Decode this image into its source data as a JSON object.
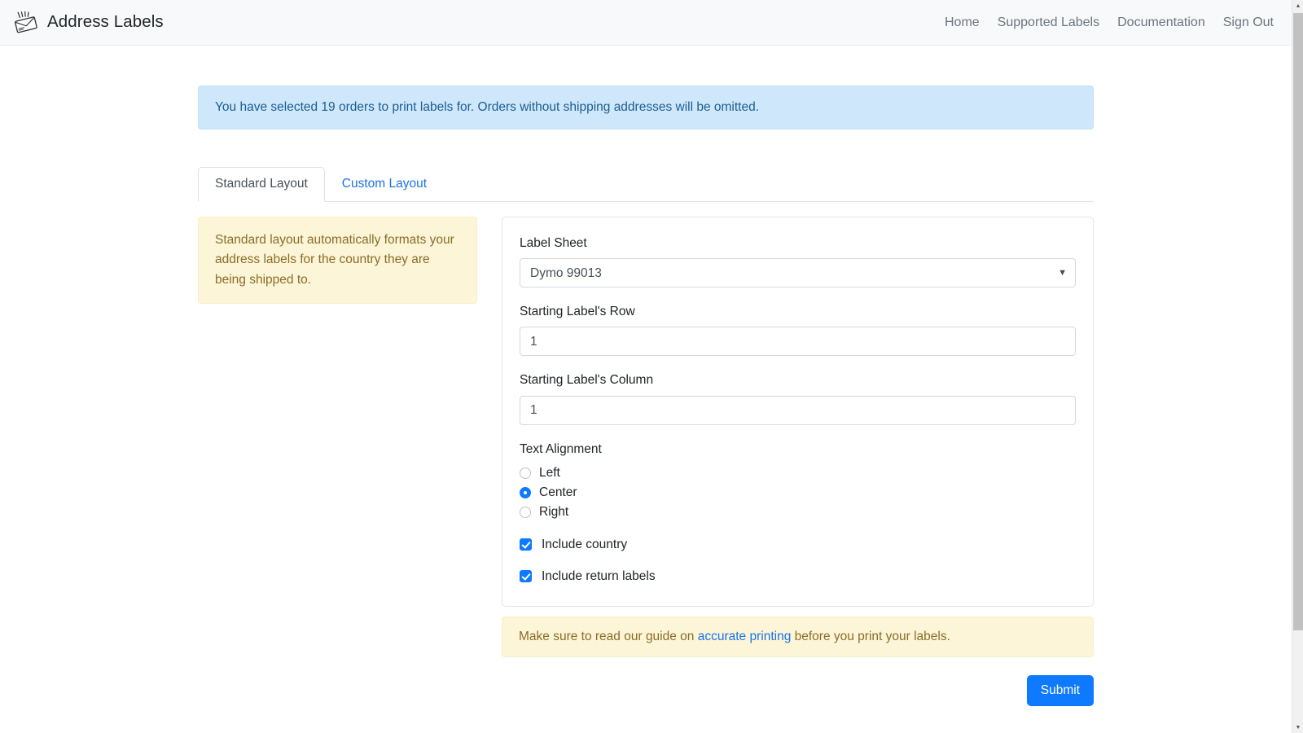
{
  "navbar": {
    "brand_label": "Address Labels",
    "brand_icon": "mail-envelope-icon",
    "links": [
      {
        "label": "Home",
        "name": "nav-link-home"
      },
      {
        "label": "Supported Labels",
        "name": "nav-link-supported-labels"
      },
      {
        "label": "Documentation",
        "name": "nav-link-documentation"
      },
      {
        "label": "Sign Out",
        "name": "nav-link-sign-out"
      }
    ]
  },
  "alert": {
    "message": "You have selected 19 orders to print labels for. Orders without shipping addresses will be omitted.",
    "selected_orders": 19,
    "background_color": "#cfe7fb",
    "text_color": "#1b5d91"
  },
  "tabs": [
    {
      "label": "Standard Layout",
      "active": true
    },
    {
      "label": "Custom Layout",
      "active": false
    }
  ],
  "side_note": {
    "text": "Standard layout automatically formats your address labels for the country they are being shipped to."
  },
  "form": {
    "label_sheet": {
      "label": "Label Sheet",
      "value": "Dymo 99013",
      "caret_icon": "chevron-down-icon"
    },
    "starting_row": {
      "label": "Starting Label's Row",
      "value": "1"
    },
    "starting_column": {
      "label": "Starting Label's Column",
      "value": "1"
    },
    "text_alignment": {
      "label": "Text Alignment",
      "selected": "Center",
      "options": [
        {
          "label": "Left",
          "checked": false
        },
        {
          "label": "Center",
          "checked": true
        },
        {
          "label": "Right",
          "checked": false
        }
      ]
    },
    "checkboxes": [
      {
        "label": "Include country",
        "checked": true
      },
      {
        "label": "Include return labels",
        "checked": true
      }
    ]
  },
  "foot_note": {
    "prefix": "Make sure to read our guide on ",
    "link_text": "accurate printing",
    "suffix": " before you print your labels."
  },
  "submit": {
    "label": "Submit",
    "color": "#0d7aff"
  },
  "scrollbar": {
    "up_arrow": "caret-up-icon",
    "down_arrow": "caret-down-icon"
  }
}
